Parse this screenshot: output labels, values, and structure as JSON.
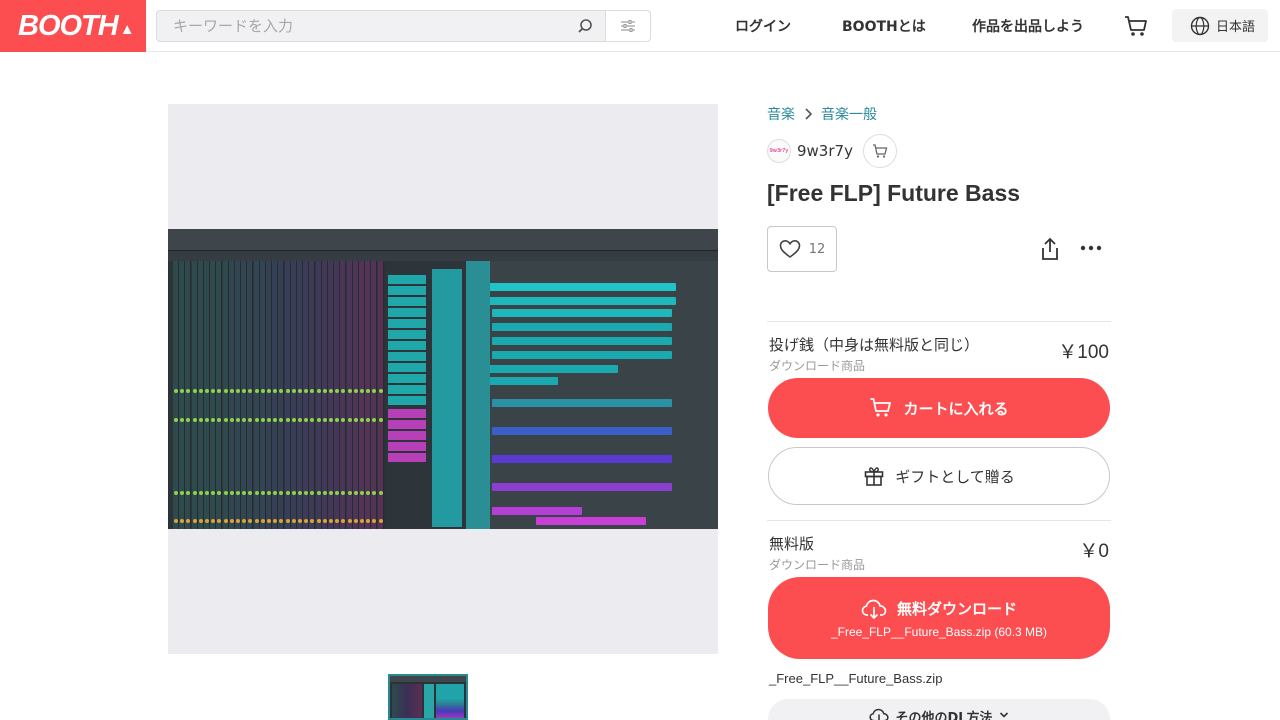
{
  "header": {
    "logo": "BOOTH",
    "search_placeholder": "キーワードを入力",
    "nav": {
      "login": "ログイン",
      "about": "BOOTHとは",
      "sell": "作品を出品しよう"
    },
    "language": "日本語"
  },
  "breadcrumb": [
    "音楽",
    "音楽一般"
  ],
  "seller": {
    "name": "9w3r7y",
    "avatar_text": "9w3r7y"
  },
  "product": {
    "title": "[Free FLP] Future Bass",
    "likes": "12"
  },
  "variants": [
    {
      "name": "投げ銭（中身は無料版と同じ）",
      "type": "ダウンロード商品",
      "price": "￥100",
      "primary_label": "カートに入れる",
      "secondary_label": "ギフトとして贈る"
    },
    {
      "name": "無料版",
      "type": "ダウンロード商品",
      "price": "￥0",
      "primary_label": "無料ダウンロード",
      "primary_sub": "_Free_FLP__Future_Bass.zip (60.3 MB)"
    }
  ],
  "download": {
    "filename": "_Free_FLP__Future_Bass.zip",
    "other_label": "その他のDL方法"
  },
  "colors": {
    "brand": "#fc4d50",
    "link": "#2a8a9c"
  }
}
